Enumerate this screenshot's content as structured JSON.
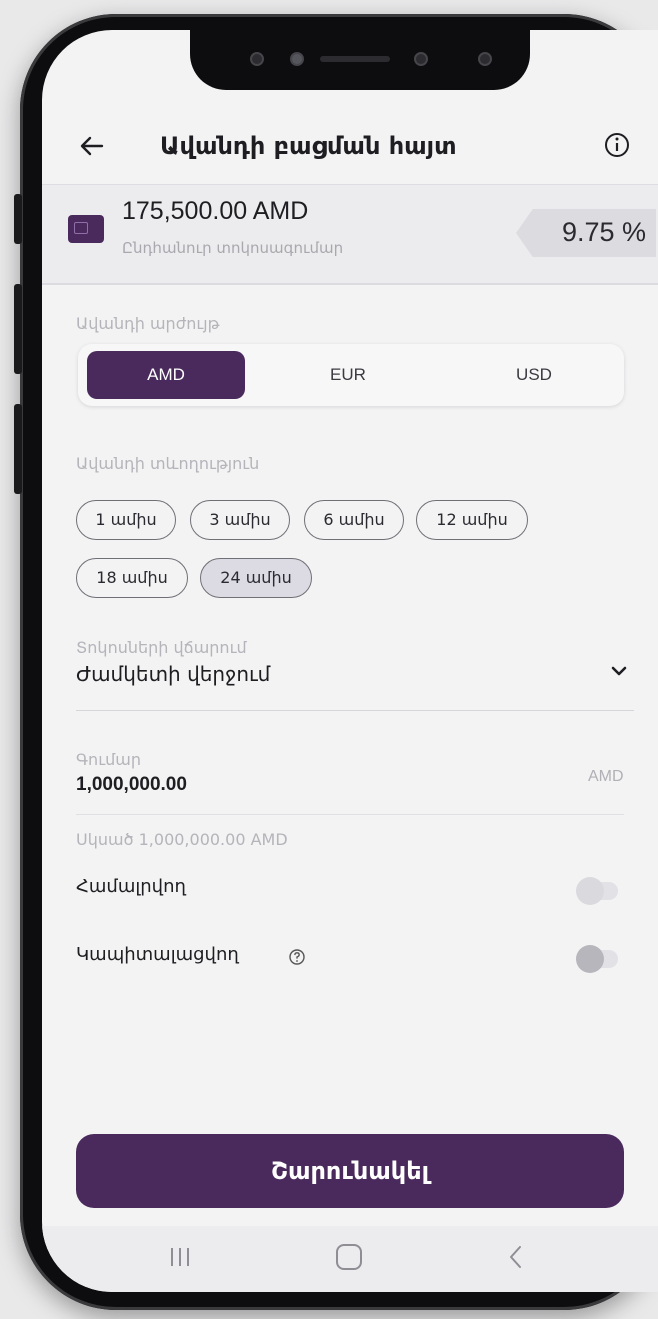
{
  "header": {
    "title": "Ավանդի բացման հայտ"
  },
  "balance": {
    "amount": "175,500.00 AMD",
    "label": "Ընդհանուր տոկոսագումար",
    "rate": "9.75 %"
  },
  "currency": {
    "label": "Ավանդի արժույթ",
    "options": [
      "AMD",
      "EUR",
      "USD"
    ],
    "selected": "AMD"
  },
  "term": {
    "label": "Ավանդի տևողություն",
    "options": [
      "1 ամիս",
      "3 ամիս",
      "6 ամիս",
      "12 ամիս",
      "18 ամիս",
      "24 ամիս"
    ],
    "selected": "24 ամիս"
  },
  "payout": {
    "label": "Տոկոսների վճարում",
    "value": "Ժամկետի վերջում"
  },
  "amount_field": {
    "label": "Գումար",
    "value": "1,000,000.00",
    "currency": "AMD",
    "minimum": "Սկսած 1,000,000.00 AMD"
  },
  "options": [
    {
      "label": "Համալրվող",
      "enabled": false
    },
    {
      "label": "Կապիտալացվող",
      "enabled": false
    }
  ],
  "submit_label": "Շարունակել",
  "colors": {
    "brand": "#4a2a5c",
    "background": "#f3f3f4"
  }
}
